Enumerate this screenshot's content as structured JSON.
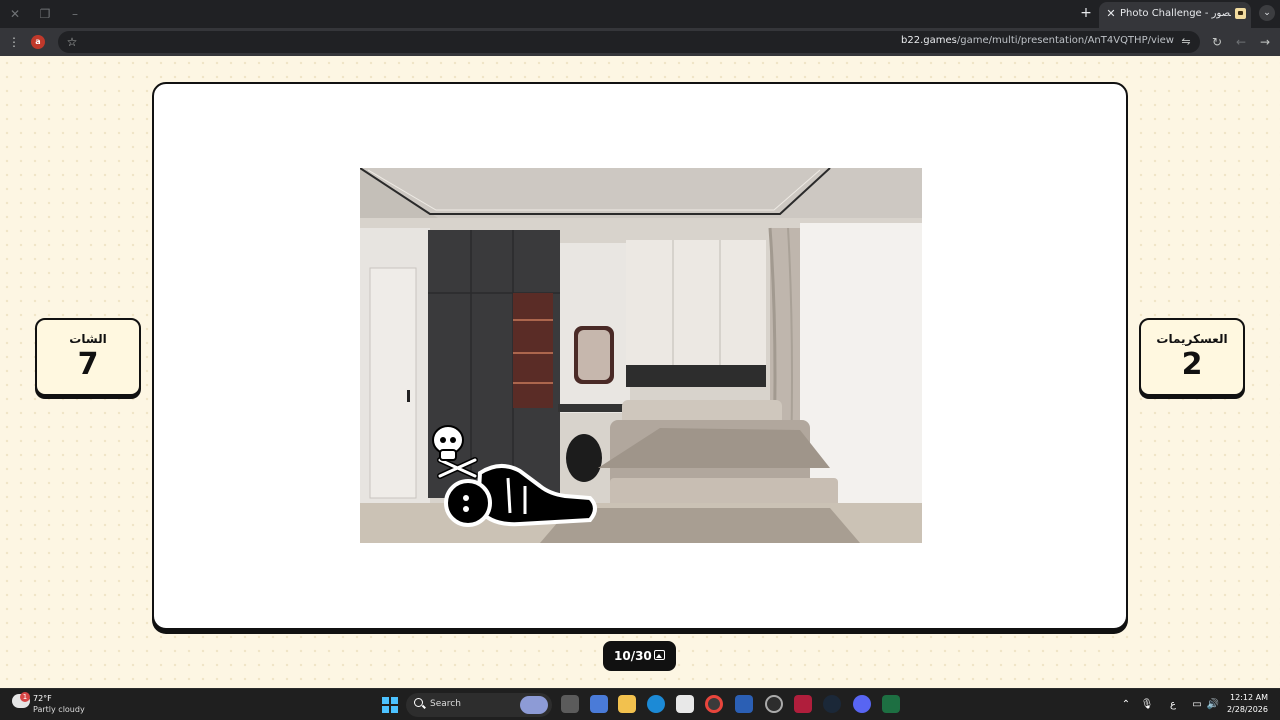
{
  "browser": {
    "tab_title": "Photo Challenge - تحدي الصور",
    "tab_close_glyph": "✕",
    "new_tab_glyph": "+",
    "tab_menu_glyph": "⌄",
    "url_domain": "b22.games",
    "url_path": "/game/multi/presentation/AnT4VQTHP/view",
    "extension_label": "a",
    "icons": [
      "back-icon",
      "forward-icon",
      "reload-icon",
      "star-icon",
      "menu-icon",
      "tune-icon"
    ]
  },
  "game": {
    "left_team": {
      "name": "الشات",
      "score": "7"
    },
    "right_team": {
      "name": "العسكريمات",
      "score": "2"
    },
    "counter": "10/30",
    "colors": {
      "page_background": "#fdf6e3",
      "card_background": "#fff8e0",
      "outline": "#111111"
    }
  },
  "taskbar": {
    "weather_temp": "72°F",
    "weather_desc": "Partly cloudy",
    "weather_badge": "1",
    "search_label": "Search",
    "keyboard_lang": "ع",
    "time": "12:12 AM",
    "date": "2/28/2026"
  }
}
